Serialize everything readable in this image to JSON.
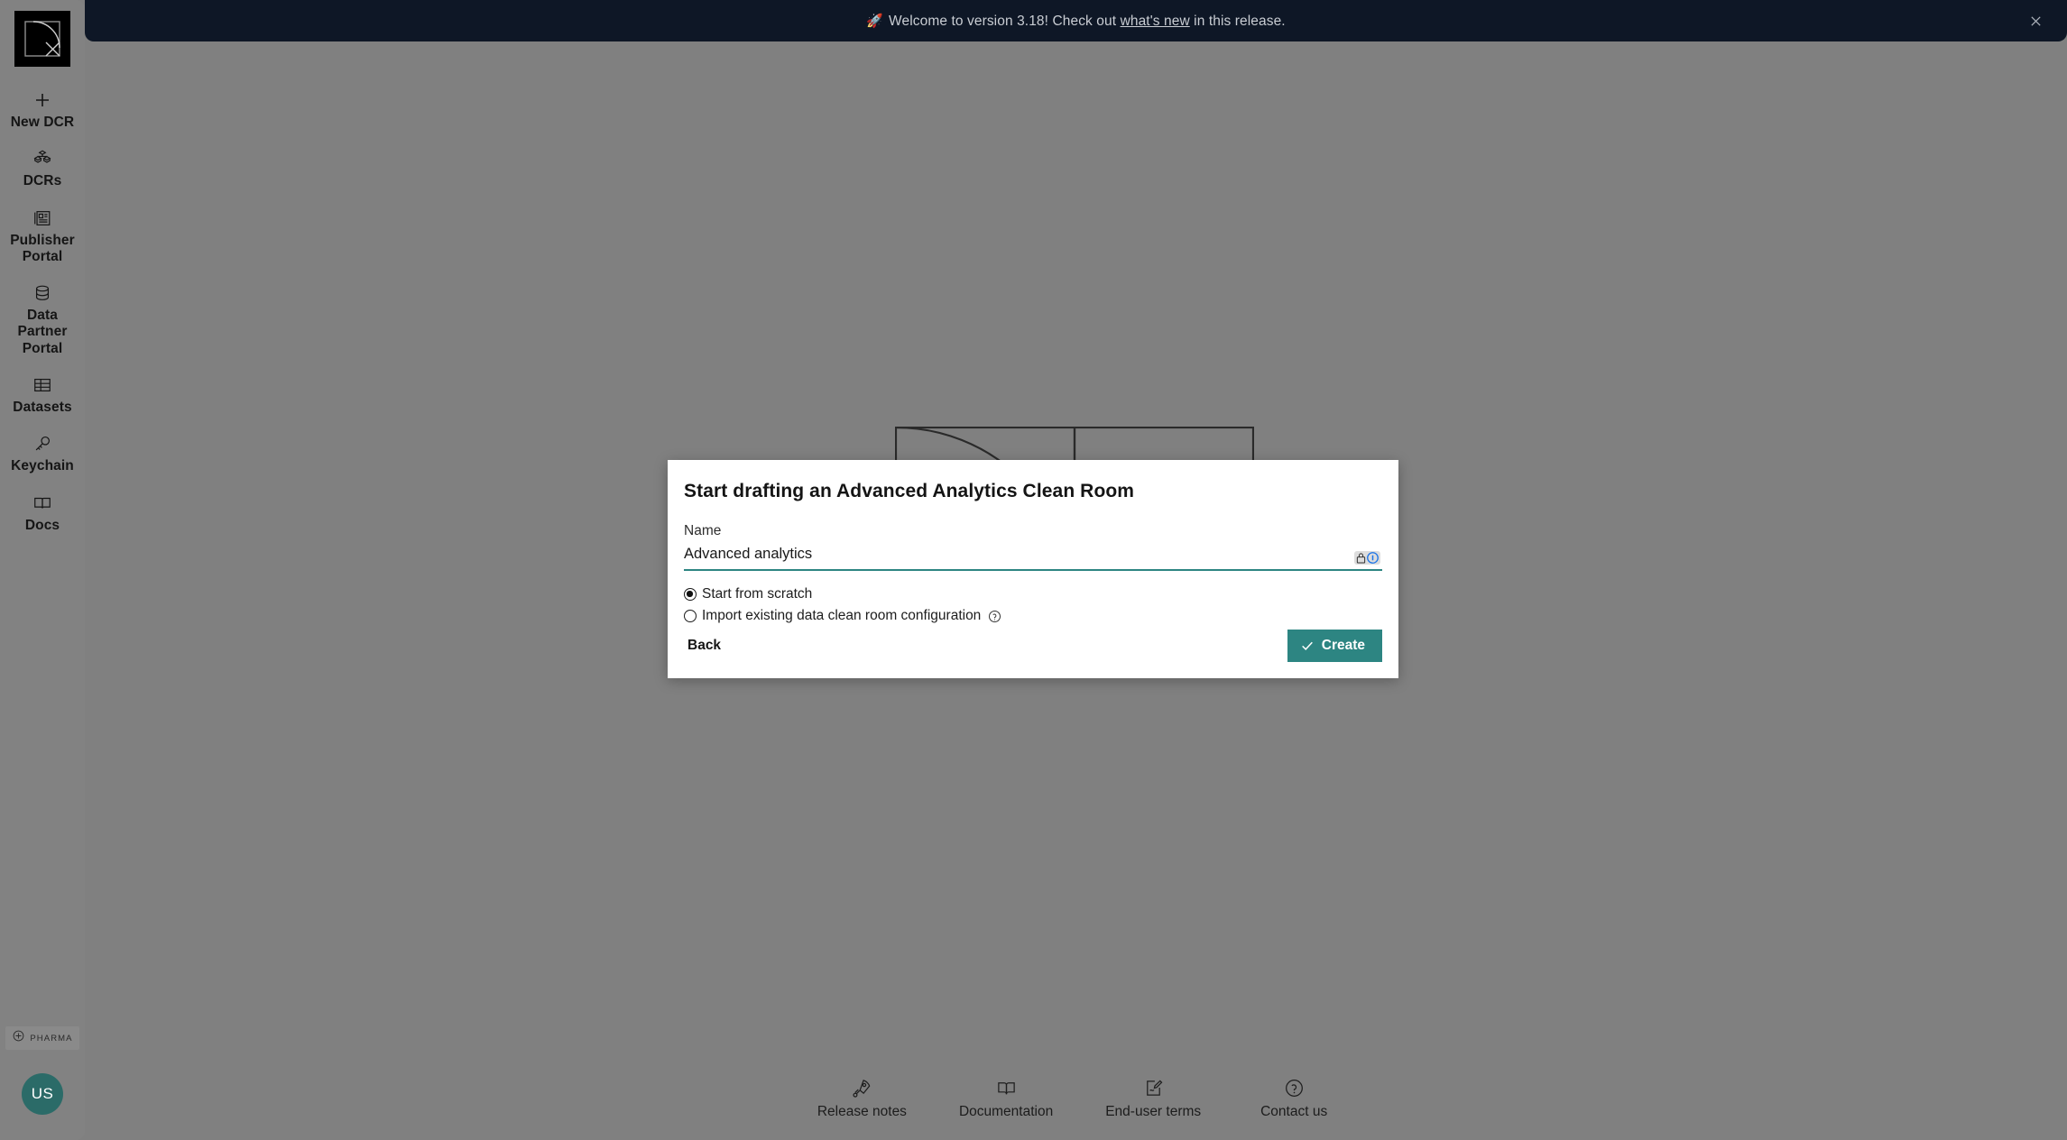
{
  "banner": {
    "emoji": "🚀",
    "text_before": "Welcome to version 3.18! Check out ",
    "link": "what's new",
    "text_after": " in this release.",
    "close_label": "×"
  },
  "sidebar": {
    "logo_name": "decentriq-logo",
    "items": [
      {
        "label": "New DCR",
        "icon": "plus-icon"
      },
      {
        "label": "DCRs",
        "icon": "cubes-icon"
      },
      {
        "label": "Publisher Portal",
        "icon": "newspaper-icon"
      },
      {
        "label": "Data Partner Portal",
        "icon": "database-icon"
      },
      {
        "label": "Datasets",
        "icon": "table-icon"
      },
      {
        "label": "Keychain",
        "icon": "key-icon"
      },
      {
        "label": "Docs",
        "icon": "book-icon"
      }
    ],
    "org_badge": {
      "text": "PHARMA",
      "icon": "cross-circle-icon"
    },
    "avatar_initials": "US"
  },
  "modal": {
    "title": "Start drafting an Advanced Analytics Clean Room",
    "name_label": "Name",
    "name_value": "Advanced analytics",
    "name_placeholder": "Name",
    "autofill_icons": [
      "lock-icon",
      "info-circle-icon"
    ],
    "options": [
      {
        "label": "Start from scratch",
        "checked": true,
        "has_help": false
      },
      {
        "label": "Import existing data clean room configuration",
        "checked": false,
        "has_help": true
      }
    ],
    "back_label": "Back",
    "create_label": "Create",
    "create_icon": "check-icon",
    "accent_color": "#2d8582"
  },
  "footer": {
    "items": [
      {
        "label": "Release notes",
        "icon": "rocket-icon"
      },
      {
        "label": "Documentation",
        "icon": "book-open-icon"
      },
      {
        "label": "End-user terms",
        "icon": "document-signature-icon"
      },
      {
        "label": "Contact us",
        "icon": "question-circle-icon"
      }
    ]
  }
}
